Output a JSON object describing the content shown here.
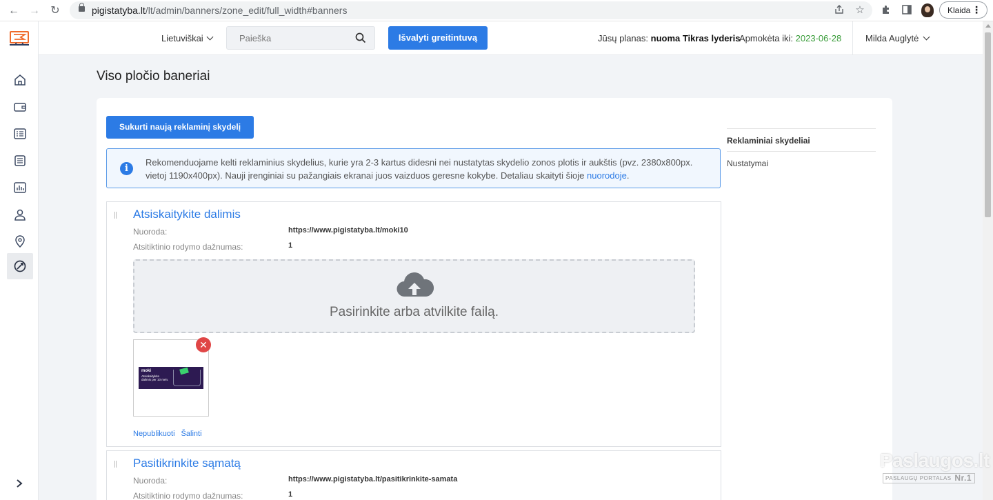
{
  "browser": {
    "url_host": "pigistatyba.lt",
    "url_path": "/lt/admin/banners/zone_edit/full_width#banners",
    "profile_label": "Klaida"
  },
  "topbar": {
    "language": "Lietuviškai",
    "search_placeholder": "Paieška",
    "clear_cache_label": "Išvalyti greitintuvą",
    "plan_label": "Jūsų planas:",
    "plan_value": "nuoma Tikras lyderis",
    "paid_label": "Apmokėta iki:",
    "paid_date": "2023-06-28",
    "user_name": "Milda Auglytė"
  },
  "page": {
    "title": "Viso pločio baneriai",
    "create_button": "Sukurti naują reklaminį skydelį",
    "info_text": "Rekomenduojame kelti reklaminius skydelius, kurie yra 2-3 kartus didesni nei nustatytas skydelio zonos plotis ir aukštis (pvz. 2380x800px. vietoj 1190x400px). Nauji įrenginiai su pažangiais ekranai juos vaizduos geresne kokybe. Detaliau skaityti šioje ",
    "info_link": "nuorodoje",
    "info_end": "."
  },
  "side_menu": {
    "items": [
      "Reklaminiai skydeliai",
      "Nustatymai"
    ]
  },
  "banners": [
    {
      "title": "Atsiskaitykite dalimis",
      "link_label": "Nuoroda:",
      "link_value": "https://www.pigistatyba.lt/moki10",
      "freq_label": "Atsitiktinio rodymo dažnumas:",
      "freq_value": "1",
      "dropzone_text": "Pasirinkite arba atvilkite failą.",
      "thumb_brand": "moki",
      "thumb_text": "Atsiskaitykite dalimis per 10 mėn.",
      "unpublish": "Nepublikuoti",
      "delete": "Šalinti"
    },
    {
      "title": "Pasitikrinkite sąmatą",
      "link_label": "Nuoroda:",
      "link_value": "https://www.pigistatyba.lt/pasitikrinkite-samata",
      "freq_label": "Atsitiktinio rodymo dažnumas:",
      "freq_value": "1"
    }
  ],
  "watermark": {
    "name": "Paslaugos.lt",
    "tagline": "PASLAUGŲ PORTALAS",
    "rank": "Nr.1"
  },
  "colors": {
    "accent": "#2c7be5",
    "paid_date": "#3a9d3a",
    "remove": "#e04646"
  }
}
